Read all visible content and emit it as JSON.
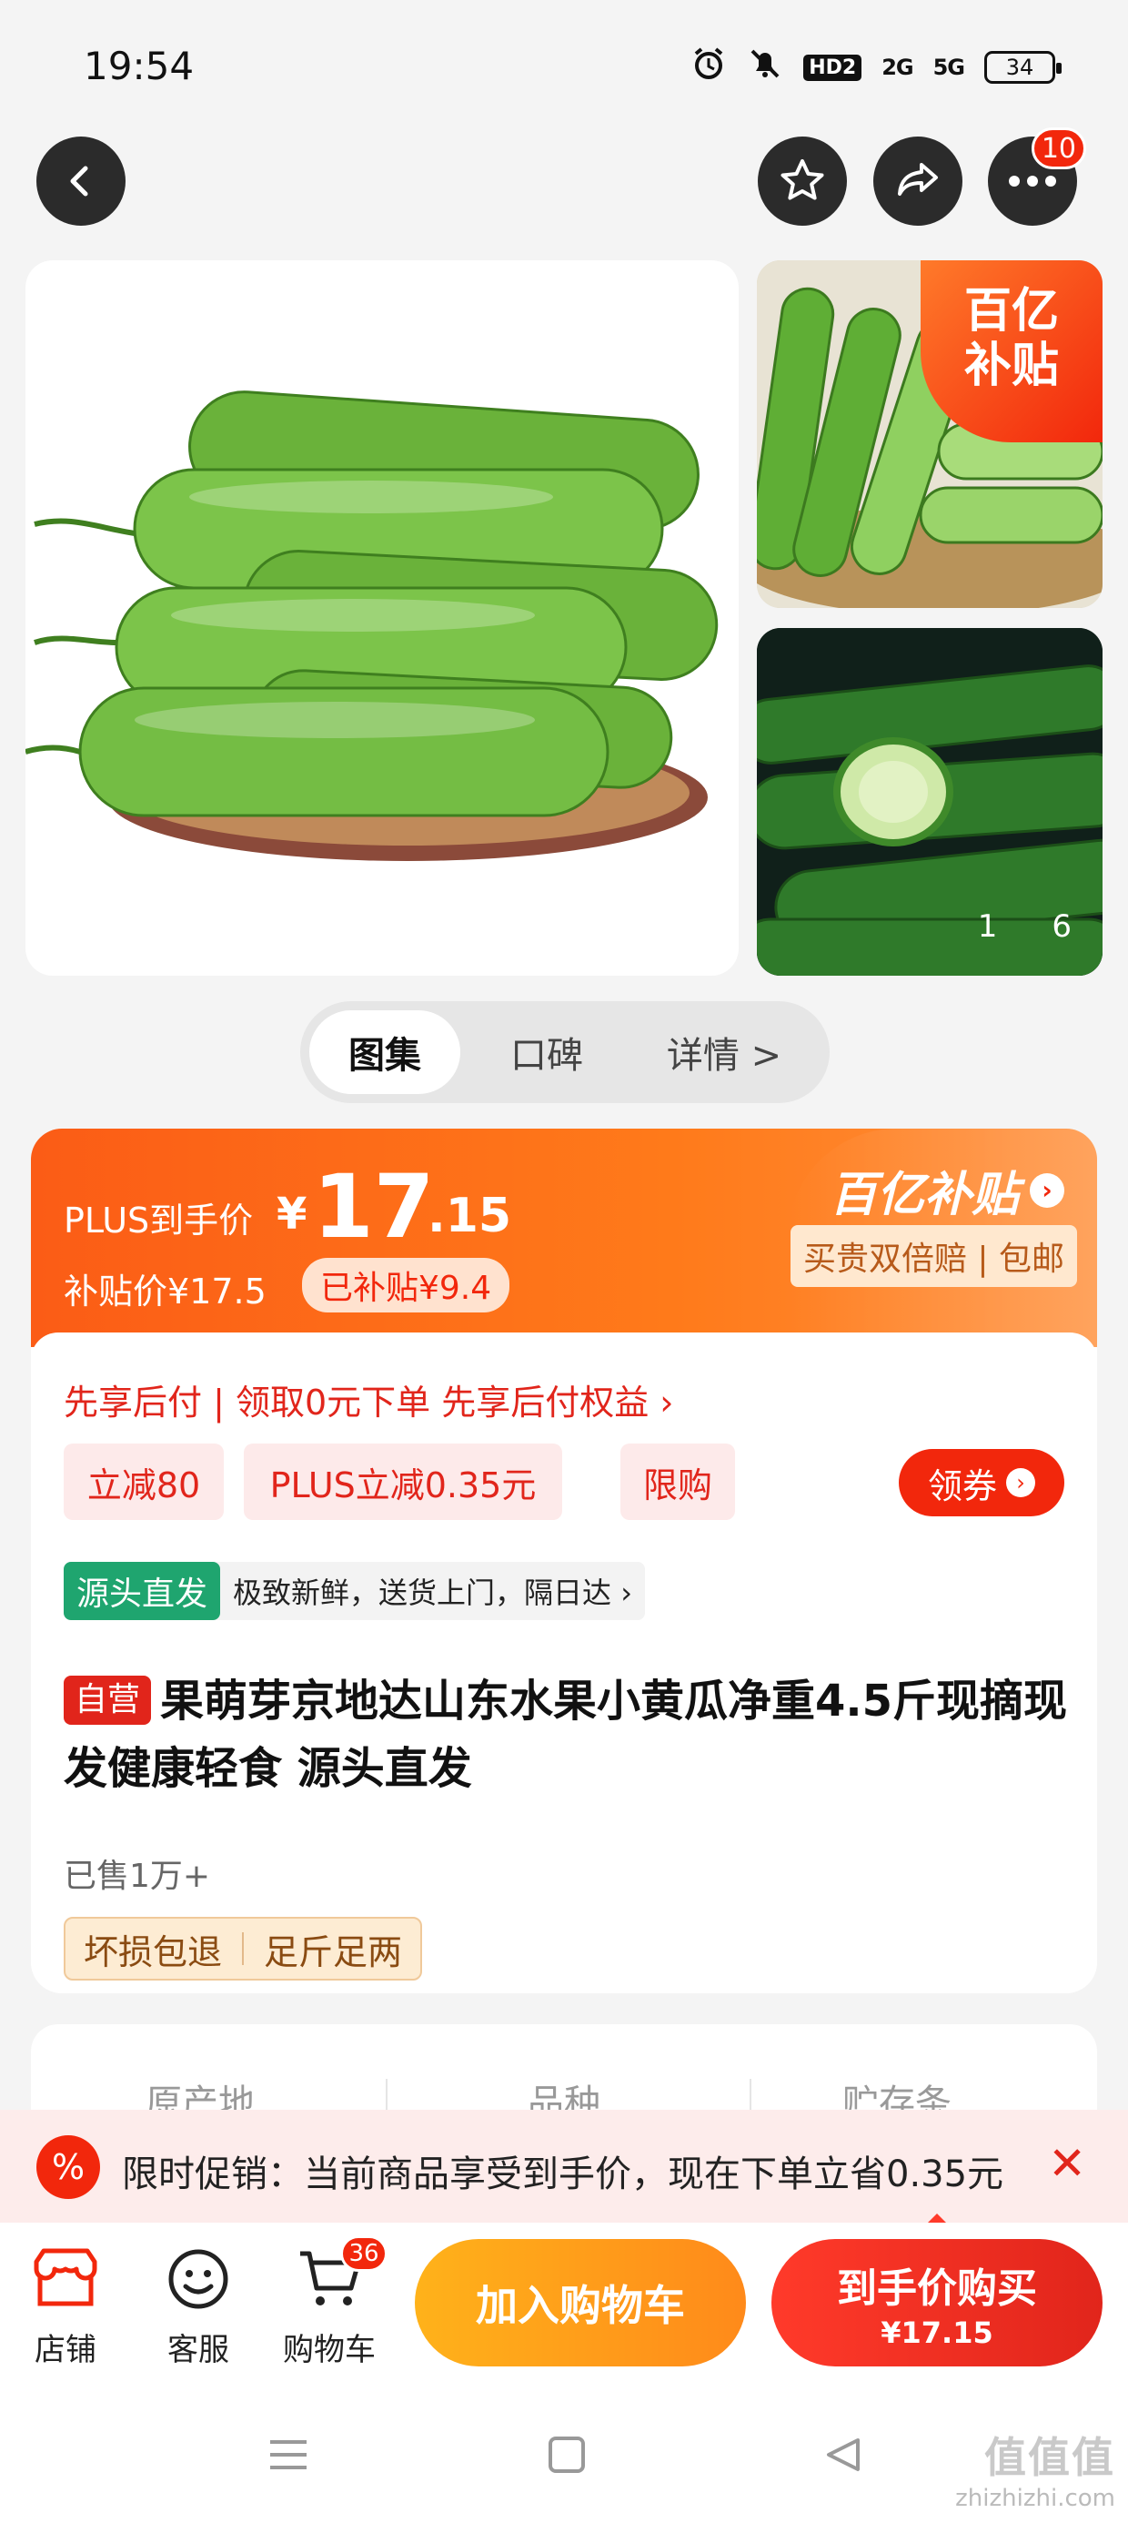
{
  "status": {
    "time": "19:54",
    "hd": "HD2",
    "net1": "2G",
    "net2": "5G",
    "battery": "34"
  },
  "nav": {
    "more_badge": "10"
  },
  "gallery": {
    "subsidy_corner": "百亿补贴",
    "counter_current": "1",
    "counter_total": "6"
  },
  "tabs": [
    {
      "label": "图集"
    },
    {
      "label": "口碑"
    },
    {
      "label": "详情 >"
    }
  ],
  "price": {
    "plus_label": "PLUS到手价",
    "yen": "¥",
    "integer": "17",
    "decimal": ".15",
    "subsidy_price": "补贴价¥17.5",
    "subsidy_chip": "已补贴¥9.4",
    "brand": "百亿补贴",
    "brand_tag": "买贵双倍赔 | 包邮"
  },
  "offers": {
    "bnpl": "先享后付 | 领取0元下单 先享后付权益 ›",
    "chips": [
      "立减80",
      "PLUS立减0.35元",
      "限购"
    ],
    "coupon_button": "领券"
  },
  "source": {
    "tag": "源头直发",
    "text": "极致新鲜，送货上门，隔日达 ›"
  },
  "product": {
    "self_tag": "自营",
    "title": "果萌芽京地达山东水果小黄瓜净重4.5斤现摘现发健康轻食 源头直发",
    "sold": "已售1万+",
    "guarantees": [
      "坏损包退",
      "足斤足两"
    ]
  },
  "attributes": [
    "原产地",
    "品种",
    "贮存条"
  ],
  "promo_bar": {
    "text": "限时促销：当前商品享受到手价，现在下单立省0.35元",
    "icon": "%"
  },
  "bottom": {
    "shop": "店铺",
    "service": "客服",
    "cart": "购物车",
    "cart_badge": "36",
    "add_to_cart": "加入购物车",
    "buy_main": "到手价购买",
    "buy_price": "¥17.15"
  },
  "watermark": {
    "site": "值值值",
    "url": "zhizhizhi.com"
  },
  "colors": {
    "accent": "#f2270c",
    "orange": "#ff7a1a",
    "green": "#1fa56f",
    "yellow": "#ffb21a"
  }
}
